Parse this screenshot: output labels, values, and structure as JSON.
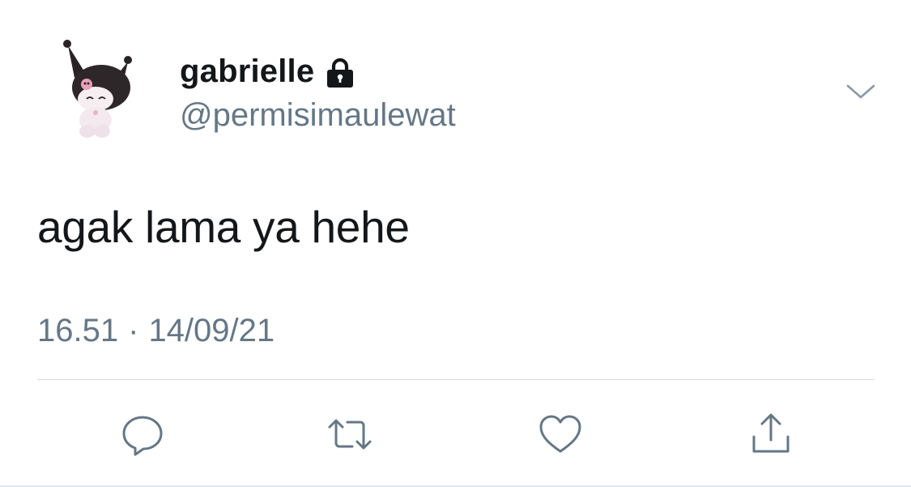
{
  "tweet": {
    "author": {
      "display_name": "gabrielle",
      "handle": "@permisimaulewat",
      "protected_icon": "lock-icon",
      "avatar_icon": "kuromi-avatar"
    },
    "text": "agak lama ya hehe",
    "time": "16.51",
    "separator": "·",
    "date": "14/09/21",
    "menu_icon": "chevron-down-icon"
  },
  "actions": [
    {
      "icon": "reply-icon"
    },
    {
      "icon": "retweet-icon"
    },
    {
      "icon": "like-icon"
    },
    {
      "icon": "share-icon"
    }
  ],
  "colors": {
    "text_primary": "#14171a",
    "text_secondary": "#657786",
    "icon": "#657786",
    "divider": "#d6dadd"
  }
}
